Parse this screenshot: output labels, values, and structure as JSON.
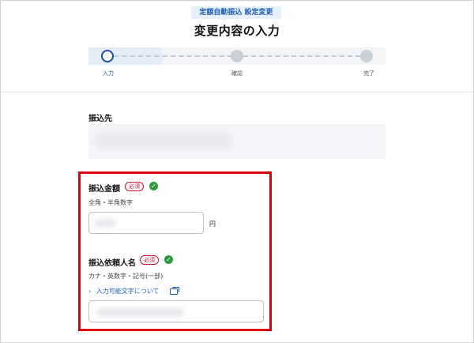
{
  "header": {
    "badge": "定額自動振込 設定変更",
    "title": "変更内容の入力"
  },
  "stepper": {
    "steps": [
      {
        "label": "入力",
        "state": "current"
      },
      {
        "label": "確認",
        "state": "pending"
      },
      {
        "label": "完了",
        "state": "pending"
      }
    ]
  },
  "destination": {
    "label": "振込先"
  },
  "amount": {
    "label": "振込金額",
    "required": "必須",
    "hint": "全角・半角数字",
    "unit": "円"
  },
  "requester": {
    "label": "振込依頼人名",
    "required": "必須",
    "hint": "カナ・英数字・記号(一部)",
    "link": "入力可能文字について"
  },
  "colors": {
    "accent": "#1d4f91",
    "required": "#c8102e",
    "valid": "#2e9a3e",
    "highlight": "#d8000c"
  }
}
